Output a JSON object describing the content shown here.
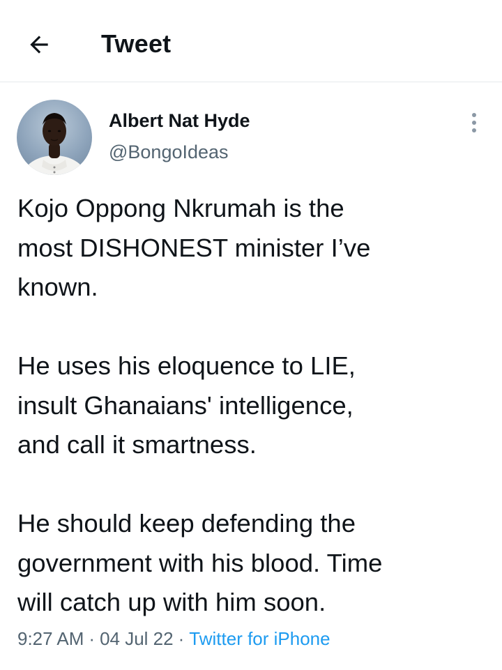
{
  "header": {
    "title": "Tweet",
    "back_icon": "arrow-left-icon"
  },
  "author": {
    "display_name": "Albert Nat Hyde",
    "handle": "@BongoIdeas",
    "avatar_icon": "profile-photo"
  },
  "more_icon": "vertical-ellipsis-icon",
  "tweet": {
    "paragraphs": [
      "Kojo Oppong Nkrumah is the\nmost DISHONEST minister I’ve\nknown.",
      "He uses his eloquence to LIE,\ninsult Ghanaians' intelligence,\nand call it smartness.",
      "He should keep defending the\ngovernment with his blood. Time\nwill catch up with him soon."
    ]
  },
  "meta": {
    "time": "9:27 AM",
    "date": "04 Jul 22",
    "separator": "·",
    "source": "Twitter for iPhone"
  },
  "colors": {
    "text_primary": "#0f1419",
    "text_secondary": "#536471",
    "link": "#1d9bf0",
    "divider": "#e6e9ec"
  }
}
